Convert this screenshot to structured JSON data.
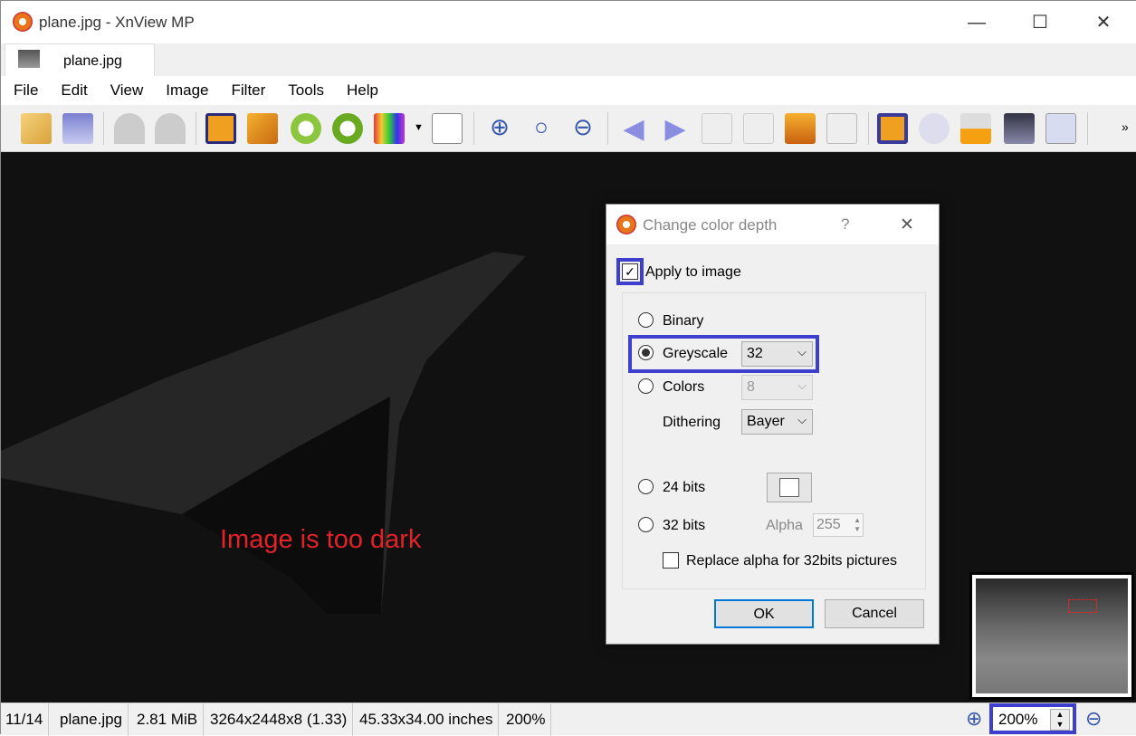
{
  "window": {
    "title": "plane.jpg - XnView MP",
    "minimize": "—",
    "maximize": "☐",
    "close": "✕"
  },
  "tab": {
    "label": "plane.jpg"
  },
  "menu": [
    "File",
    "Edit",
    "View",
    "Image",
    "Filter",
    "Tools",
    "Help"
  ],
  "toolbar": {
    "overflow": "»"
  },
  "viewer": {
    "annotation": "Image is too dark"
  },
  "dialog": {
    "title": "Change color depth",
    "help": "?",
    "close": "✕",
    "apply_label": "Apply to image",
    "apply_checked": true,
    "binary": "Binary",
    "greyscale": "Greyscale",
    "greyscale_value": "32",
    "colors": "Colors",
    "colors_value": "8",
    "dithering": "Dithering",
    "dithering_value": "Bayer",
    "bits24": "24 bits",
    "bits32": "32 bits",
    "alpha": "Alpha",
    "alpha_value": "255",
    "replace_alpha": "Replace alpha for 32bits pictures",
    "replace_alpha_checked": false,
    "selected": "Greyscale",
    "ok": "OK",
    "cancel": "Cancel"
  },
  "status": {
    "index": "11/14",
    "filename": "plane.jpg",
    "size": "2.81 MiB",
    "dims": "3264x2448x8 (1.33)",
    "inches": "45.33x34.00 inches",
    "zoom": "200%",
    "zoom_input": "200%"
  }
}
